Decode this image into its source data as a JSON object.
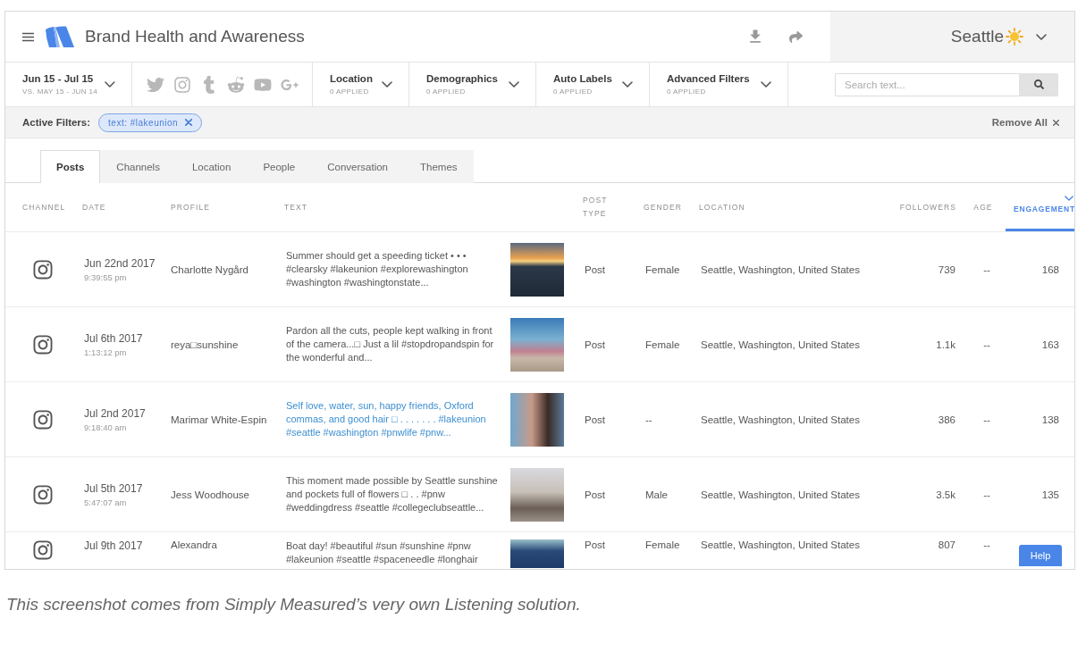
{
  "header": {
    "title": "Brand Health and Awareness",
    "location": "Seattle"
  },
  "filters": {
    "date_range": {
      "label": "Jun 15 - Jul 15",
      "comparison": "VS. MAY 15 - JUN 14"
    },
    "dropdowns": [
      {
        "label": "Location",
        "applied": "0 APPLIED"
      },
      {
        "label": "Demographics",
        "applied": "0 APPLIED"
      },
      {
        "label": "Auto Labels",
        "applied": "0 APPLIED"
      },
      {
        "label": "Advanced Filters",
        "applied": "0 APPLIED"
      }
    ],
    "search": {
      "placeholder": "Search text..."
    }
  },
  "active_filters": {
    "label": "Active Filters:",
    "chips": [
      "text: #lakeunion"
    ],
    "remove_all": "Remove All"
  },
  "tabs": [
    {
      "label": "Posts",
      "selected": true
    },
    {
      "label": "Channels",
      "selected": false
    },
    {
      "label": "Location",
      "selected": false
    },
    {
      "label": "People",
      "selected": false
    },
    {
      "label": "Conversation",
      "selected": false
    },
    {
      "label": "Themes",
      "selected": false
    }
  ],
  "table": {
    "columns": [
      {
        "label": "CHANNEL",
        "sorted": false
      },
      {
        "label": "DATE",
        "sorted": false
      },
      {
        "label": "PROFILE",
        "sorted": false
      },
      {
        "label": "TEXT",
        "sorted": false
      },
      {
        "label": "POST TYPE",
        "sorted": false
      },
      {
        "label": "GENDER",
        "sorted": false
      },
      {
        "label": "LOCATION",
        "sorted": false
      },
      {
        "label": "FOLLOWERS",
        "sorted": false
      },
      {
        "label": "AGE",
        "sorted": false
      },
      {
        "label": "ENGAGEMENT",
        "sorted": true
      }
    ],
    "rows": [
      {
        "date": "Jun 22nd 2017",
        "time": "9:39:55 pm",
        "profile": "Charlotte Nygård",
        "text": "Summer should get a speeding ticket • • • #clearsky #lakeunion #explorewashington #washington #washingtonstate...",
        "highlighted": false,
        "post_type": "Post",
        "gender": "Female",
        "location": "Seattle, Washington, United States",
        "followers": "739",
        "age": "--",
        "engagement": "168"
      },
      {
        "date": "Jul 6th 2017",
        "time": "1:13:12 pm",
        "profile": "reya□sunshine",
        "text": "Pardon all the cuts, people kept walking in front of the camera...□ Just a lil #stopdropandspin for the wonderful and...",
        "highlighted": false,
        "post_type": "Post",
        "gender": "Female",
        "location": "Seattle, Washington, United States",
        "followers": "1.1k",
        "age": "--",
        "engagement": "163"
      },
      {
        "date": "Jul 2nd 2017",
        "time": "9:18:40 am",
        "profile": "Marimar White-Espin",
        "text": "Self love, water, sun, happy friends, Oxford commas, and good hair □ . . . . . . . #lakeunion #seattle #washington #pnwlife #pnw...",
        "highlighted": true,
        "post_type": "Post",
        "gender": "--",
        "location": "Seattle, Washington, United States",
        "followers": "386",
        "age": "--",
        "engagement": "138"
      },
      {
        "date": "Jul 5th 2017",
        "time": "5:47:07 am",
        "profile": "Jess Woodhouse",
        "text": "This moment made possible by Seattle sunshine and pockets full of flowers □ . . #pnw #weddingdress #seattle #collegeclubseattle...",
        "highlighted": false,
        "post_type": "Post",
        "gender": "Male",
        "location": "Seattle, Washington, United States",
        "followers": "3.5k",
        "age": "--",
        "engagement": "135"
      },
      {
        "date": "Jul 9th 2017",
        "profile": "Alexandra",
        "text": "Boat day! #beautiful #sun #sunshine #pnw #lakeunion #seattle #spaceneedle #longhair",
        "highlighted": false,
        "post_type": "Post",
        "gender": "Female",
        "location": "Seattle, Washington, United States",
        "followers": "807",
        "age": "--"
      }
    ]
  },
  "help_button": "Help",
  "caption": "This screenshot comes from Simply Measured’s very own Listening solution."
}
